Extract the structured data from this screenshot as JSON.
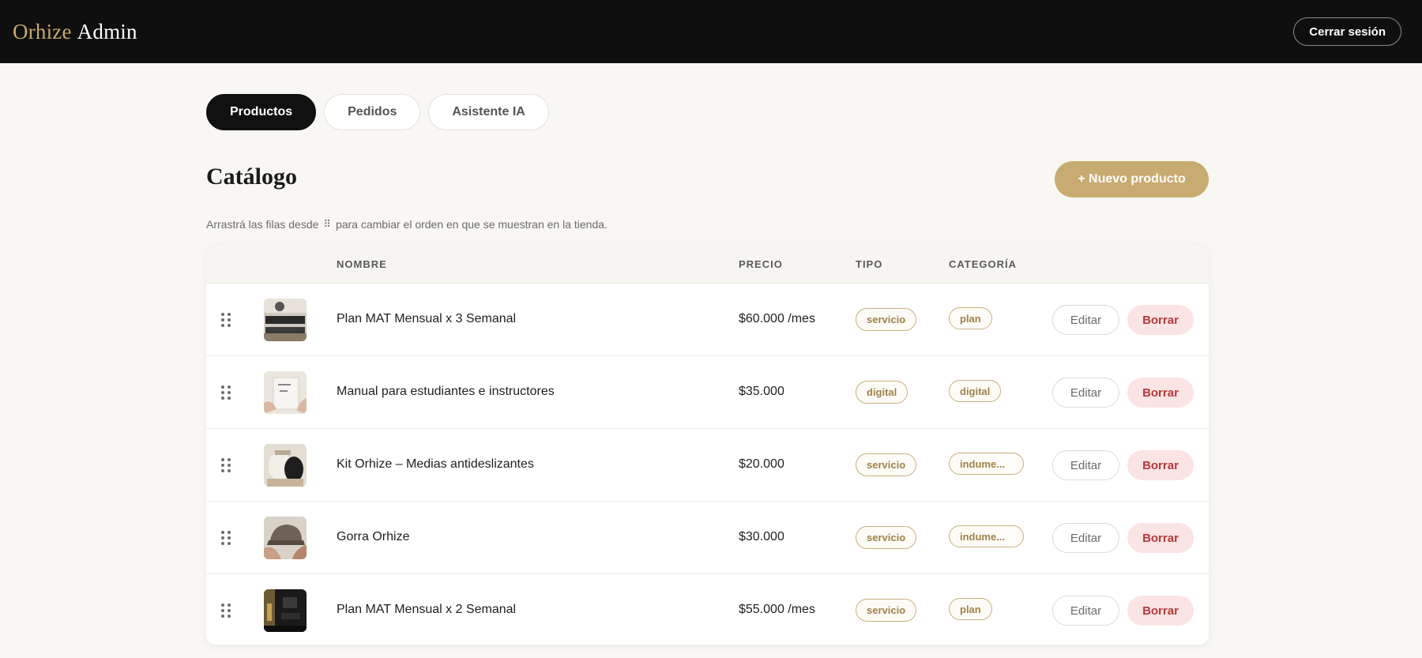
{
  "header": {
    "brand_primary": "Orhize",
    "brand_secondary": "Admin",
    "logout_label": "Cerrar sesión"
  },
  "tabs": [
    {
      "label": "Productos",
      "active": true
    },
    {
      "label": "Pedidos",
      "active": false
    },
    {
      "label": "Asistente IA",
      "active": false
    }
  ],
  "catalog": {
    "title": "Catálogo",
    "new_button": "+ Nuevo producto",
    "hint_before": "Arrastrá las filas desde",
    "hint_icon": "drag-handle-icon",
    "hint_after": "para cambiar el orden en que se muestran en la tienda."
  },
  "table": {
    "columns": {
      "name": "Nombre",
      "price": "Precio",
      "type": "Tipo",
      "category": "Categoría"
    },
    "edit_label": "Editar",
    "delete_label": "Borrar",
    "rows": [
      {
        "name": "Plan MAT Mensual x 3 Semanal",
        "price": "$60.000 /mes",
        "type": "servicio",
        "category": "plan"
      },
      {
        "name": "Manual para estudiantes e instructores",
        "price": "$35.000",
        "type": "digital",
        "category": "digital"
      },
      {
        "name": "Kit Orhize – Medias antideslizantes",
        "price": "$20.000",
        "type": "servicio",
        "category": "indume..."
      },
      {
        "name": "Gorra Orhize",
        "price": "$30.000",
        "type": "servicio",
        "category": "indume..."
      },
      {
        "name": "Plan MAT Mensual x 2 Semanal",
        "price": "$55.000 /mes",
        "type": "servicio",
        "category": "plan"
      }
    ]
  },
  "colors": {
    "accent": "#c8ab71",
    "topbar": "#0f0f0f",
    "delete_bg": "#fbe4e4",
    "delete_text": "#b3393a"
  }
}
